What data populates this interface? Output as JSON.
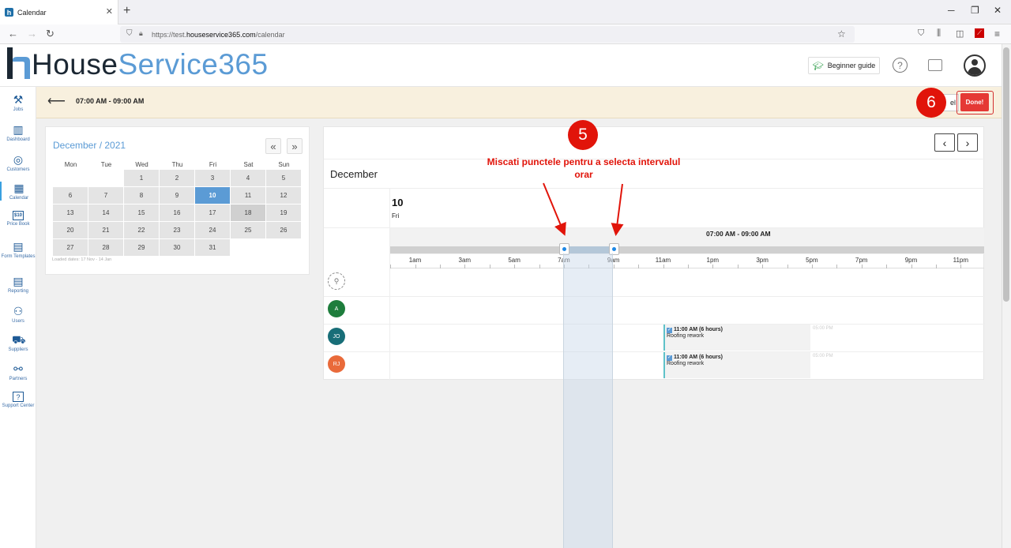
{
  "browser": {
    "tab_title": "Calendar",
    "tab_favicon": "h",
    "url_prefix": "https://test.",
    "url_domain": "houseservice365.com",
    "url_path": "/calendar"
  },
  "app": {
    "logo_part1": "House",
    "logo_part2": "Service365",
    "beginner_guide": "Beginner guide",
    "help_symbol": "?"
  },
  "sidebar": {
    "items": [
      {
        "label": "Jobs",
        "icon": "tools-icon"
      },
      {
        "label": "Dashboard",
        "icon": "chart-icon"
      },
      {
        "label": "Customers",
        "icon": "target-icon"
      },
      {
        "label": "Calendar",
        "icon": "calendar-icon"
      },
      {
        "label": "Price Book",
        "icon": "price-icon"
      },
      {
        "label": "Form Templates",
        "icon": "form-icon"
      },
      {
        "label": "Reporting",
        "icon": "report-icon"
      },
      {
        "label": "Users",
        "icon": "users-icon"
      },
      {
        "label": "Suppliers",
        "icon": "truck-icon"
      },
      {
        "label": "Partners",
        "icon": "partners-icon"
      },
      {
        "label": "Support Center",
        "icon": "support-icon"
      }
    ],
    "price_icon_text": "$10",
    "support_icon_text": "?"
  },
  "toolbar": {
    "title": "07:00 AM - 09:00 AM",
    "cancel_label": "el",
    "done_label": "Done!"
  },
  "mini_calendar": {
    "title": "December / 2021",
    "prev": "«",
    "next": "»",
    "weekdays": [
      "Mon",
      "Tue",
      "Wed",
      "Thu",
      "Fri",
      "Sat",
      "Sun"
    ],
    "weeks": [
      [
        "",
        "",
        "1",
        "2",
        "3",
        "4",
        "5"
      ],
      [
        "6",
        "7",
        "8",
        "9",
        "10",
        "11",
        "12"
      ],
      [
        "13",
        "14",
        "15",
        "16",
        "17",
        "18",
        "19"
      ],
      [
        "20",
        "21",
        "22",
        "23",
        "24",
        "25",
        "26"
      ],
      [
        "27",
        "28",
        "29",
        "30",
        "31",
        "",
        ""
      ]
    ],
    "selected_day": "10",
    "highlighted_day": "18",
    "loaded_dates": "Loaded dates: 17 Nov - 14 Jan"
  },
  "scheduler": {
    "month": "December",
    "day_number": "10",
    "day_name": "Fri",
    "range_label": "07:00 AM - 09:00 AM",
    "selection_start_hour": 7,
    "selection_end_hour": 9,
    "hour_labels": [
      "1am",
      "3am",
      "5am",
      "7am",
      "9am",
      "11am",
      "1pm",
      "3pm",
      "5pm",
      "7pm",
      "9pm",
      "11pm"
    ],
    "users": [
      {
        "initials": "A",
        "color": "#1e7d3c"
      },
      {
        "initials": "JO",
        "color": "#186e78"
      },
      {
        "initials": "RJ",
        "color": "#e96a3a"
      }
    ],
    "events": [
      {
        "user": "JO",
        "title": "11:00 AM (6 hours)",
        "subtitle": "Roofing rework",
        "end_time": "05:00 PM"
      },
      {
        "user": "RJ",
        "title": "11:00 AM (6 hours)",
        "subtitle": "Roofing rework",
        "end_time": "05:00 PM"
      }
    ]
  },
  "annotations": {
    "step5": "5",
    "step6": "6",
    "instruction": "Miscati punctele pentru a selecta intervalul orar",
    "color": "#e1140a"
  }
}
